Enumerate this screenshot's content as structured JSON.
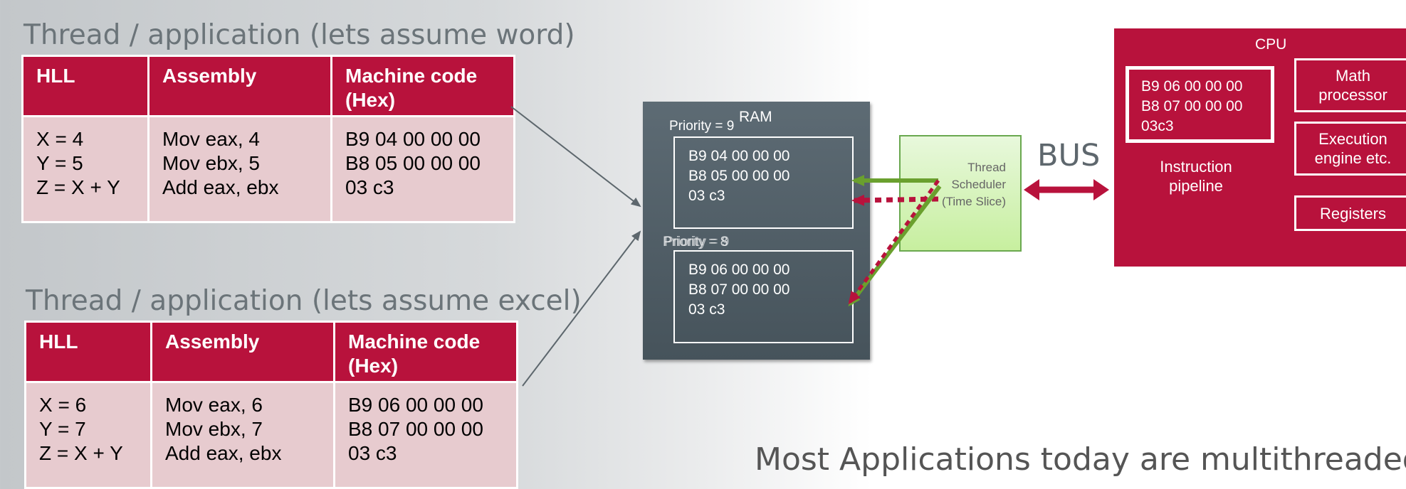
{
  "thread1": {
    "title": "Thread / application (lets assume word)",
    "headers": [
      "HLL",
      "Assembly",
      "Machine code (Hex)"
    ],
    "hll": [
      "X = 4",
      "Y = 5",
      "Z = X + Y"
    ],
    "assembly": [
      "Mov eax, 4",
      "Mov ebx, 5",
      "Add eax, ebx"
    ],
    "machine": [
      "B9 04 00 00 00",
      "B8 05 00 00 00",
      "03 c3"
    ]
  },
  "thread2": {
    "title": "Thread / application (lets assume excel)",
    "headers": [
      "HLL",
      "Assembly",
      "Machine code (Hex)"
    ],
    "hll": [
      "X = 6",
      "Y = 7",
      "Z = X + Y"
    ],
    "assembly": [
      "Mov eax, 6",
      "Mov ebx, 7",
      "Add eax, ebx"
    ],
    "machine": [
      "B9 06 00 00 00",
      "B8 07 00 00 00",
      "03 c3"
    ]
  },
  "ram": {
    "label": "RAM",
    "priority_top": "Priority = 9",
    "priority_bottom_a": "Priority = 8",
    "priority_bottom_b": "Priority = 9",
    "block1": [
      "B9 04 00 00 00",
      "B8 05 00 00 00",
      "03 c3"
    ],
    "block2": [
      "B9 06 00 00 00",
      "B8 07 00 00 00",
      "03 c3"
    ]
  },
  "scheduler": {
    "lines": [
      "Thread",
      "Scheduler",
      "(Time Slice)"
    ]
  },
  "bus": {
    "label": "BUS"
  },
  "cpu": {
    "title": "CPU",
    "pipeline_code": [
      "B9 06 00 00 00",
      "B8 07 00 00 00",
      "03c3"
    ],
    "pipeline_label": [
      "Instruction",
      "pipeline"
    ],
    "math": [
      "Math",
      "processor"
    ],
    "exec": [
      "Execution",
      "engine etc."
    ],
    "registers": "Registers"
  },
  "footer": {
    "text": "Most Applications today are multithreaded"
  },
  "colors": {
    "accent": "#b8123c",
    "cell_bg": "#e7cbcf",
    "ram_bg": "#4f5c64",
    "scheduler_bg": "#c7ef9f",
    "green_arrow": "#6aa02e"
  }
}
